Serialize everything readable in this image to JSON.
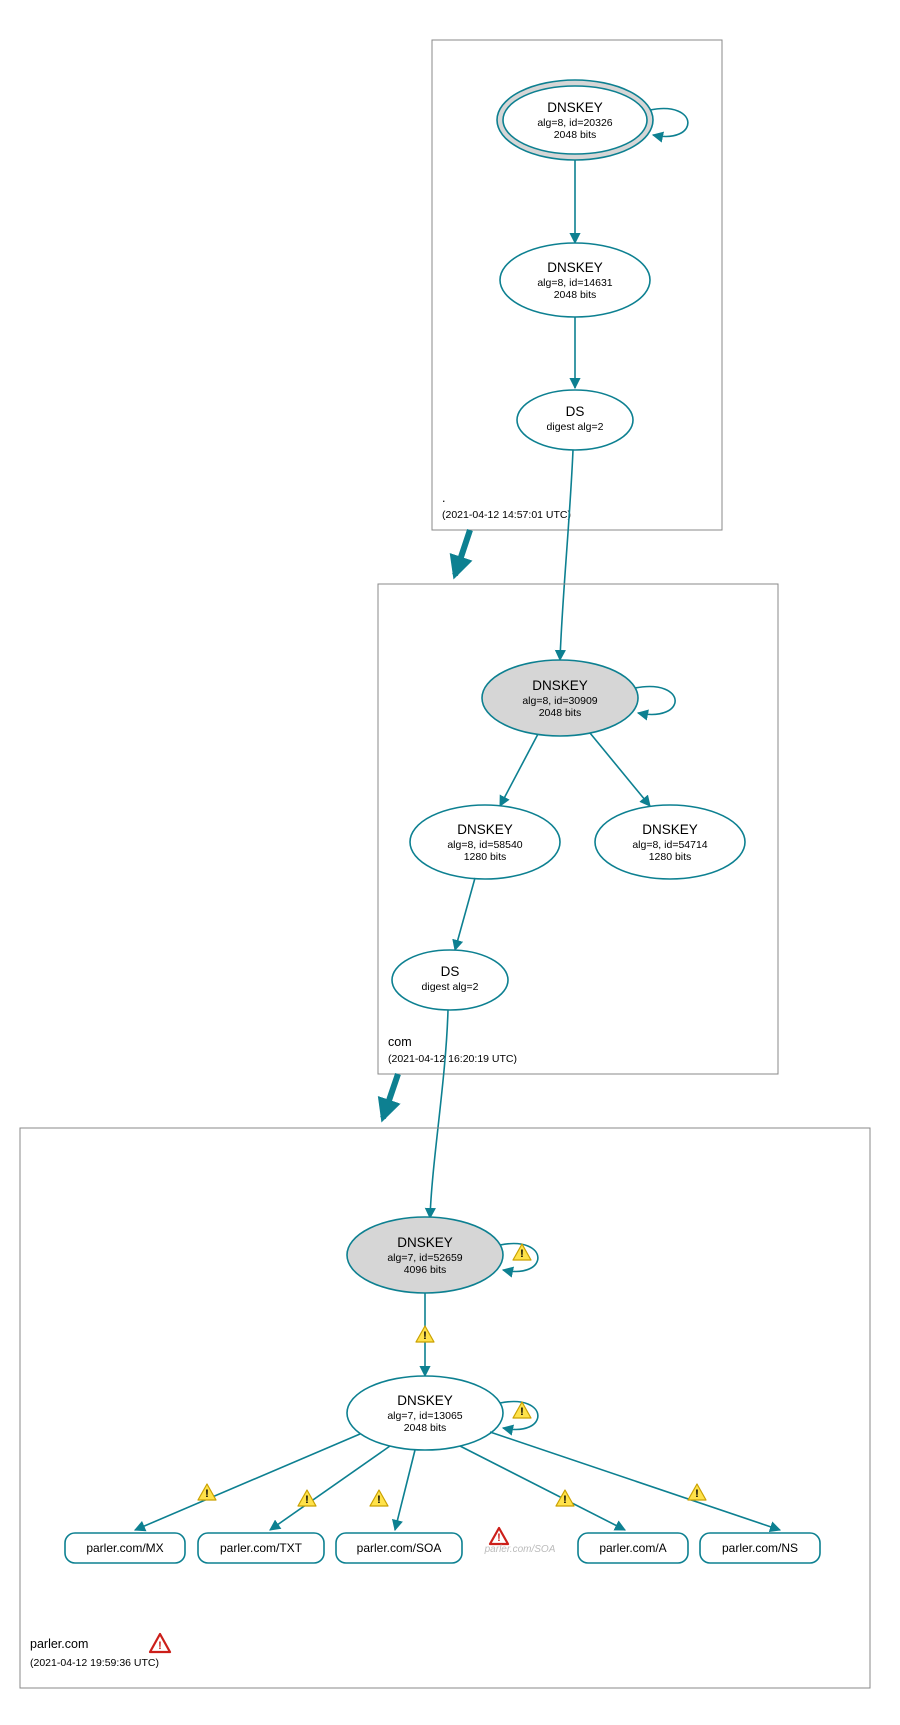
{
  "colors": {
    "accent": "#0d8091",
    "warn": "#ffe24a",
    "error": "#cc1f1a"
  },
  "zones": {
    "root": {
      "label": ".",
      "time": "(2021-04-12 14:57:01 UTC)"
    },
    "com": {
      "label": "com",
      "time": "(2021-04-12 16:20:19 UTC)"
    },
    "parler": {
      "label": "parler.com",
      "time": "(2021-04-12 19:59:36 UTC)"
    }
  },
  "nodes": {
    "root_ksk": {
      "title": "DNSKEY",
      "line1": "alg=8, id=20326",
      "line2": "2048 bits"
    },
    "root_zsk": {
      "title": "DNSKEY",
      "line1": "alg=8, id=14631",
      "line2": "2048 bits"
    },
    "root_ds": {
      "title": "DS",
      "line1": "digest alg=2"
    },
    "com_ksk": {
      "title": "DNSKEY",
      "line1": "alg=8, id=30909",
      "line2": "2048 bits"
    },
    "com_zsk1": {
      "title": "DNSKEY",
      "line1": "alg=8, id=58540",
      "line2": "1280 bits"
    },
    "com_zsk2": {
      "title": "DNSKEY",
      "line1": "alg=8, id=54714",
      "line2": "1280 bits"
    },
    "com_ds": {
      "title": "DS",
      "line1": "digest alg=2"
    },
    "parler_ksk": {
      "title": "DNSKEY",
      "line1": "alg=7, id=52659",
      "line2": "4096 bits"
    },
    "parler_zsk": {
      "title": "DNSKEY",
      "line1": "alg=7, id=13065",
      "line2": "2048 bits"
    }
  },
  "rrsets": {
    "mx": "parler.com/MX",
    "txt": "parler.com/TXT",
    "soa": "parler.com/SOA",
    "soa_dim": "parler.com/SOA",
    "a": "parler.com/A",
    "ns": "parler.com/NS"
  },
  "chart_data": {
    "type": "tree",
    "description": "DNSSEC authentication chain (DNSViz-style)",
    "zones": [
      {
        "name": ".",
        "analyzed": "2021-04-12 14:57:01 UTC"
      },
      {
        "name": "com",
        "analyzed": "2021-04-12 16:20:19 UTC"
      },
      {
        "name": "parler.com",
        "analyzed": "2021-04-12 19:59:36 UTC",
        "status": "error"
      }
    ],
    "nodes": [
      {
        "id": "root_ksk",
        "zone": ".",
        "type": "DNSKEY",
        "algorithm": 8,
        "key_id": 20326,
        "bits": 2048,
        "role": "KSK",
        "trust_anchor": true
      },
      {
        "id": "root_zsk",
        "zone": ".",
        "type": "DNSKEY",
        "algorithm": 8,
        "key_id": 14631,
        "bits": 2048,
        "role": "ZSK"
      },
      {
        "id": "root_ds",
        "zone": ".",
        "type": "DS",
        "digest_algorithm": 2
      },
      {
        "id": "com_ksk",
        "zone": "com",
        "type": "DNSKEY",
        "algorithm": 8,
        "key_id": 30909,
        "bits": 2048,
        "role": "KSK"
      },
      {
        "id": "com_zsk1",
        "zone": "com",
        "type": "DNSKEY",
        "algorithm": 8,
        "key_id": 58540,
        "bits": 1280,
        "role": "ZSK"
      },
      {
        "id": "com_zsk2",
        "zone": "com",
        "type": "DNSKEY",
        "algorithm": 8,
        "key_id": 54714,
        "bits": 1280,
        "role": "ZSK"
      },
      {
        "id": "com_ds",
        "zone": "com",
        "type": "DS",
        "digest_algorithm": 2
      },
      {
        "id": "parler_ksk",
        "zone": "parler.com",
        "type": "DNSKEY",
        "algorithm": 7,
        "key_id": 52659,
        "bits": 4096,
        "role": "KSK",
        "status": "warning"
      },
      {
        "id": "parler_zsk",
        "zone": "parler.com",
        "type": "DNSKEY",
        "algorithm": 7,
        "key_id": 13065,
        "bits": 2048,
        "role": "ZSK",
        "status": "warning"
      },
      {
        "id": "rr_mx",
        "zone": "parler.com",
        "type": "RRset",
        "name": "parler.com/MX"
      },
      {
        "id": "rr_txt",
        "zone": "parler.com",
        "type": "RRset",
        "name": "parler.com/TXT"
      },
      {
        "id": "rr_soa",
        "zone": "parler.com",
        "type": "RRset",
        "name": "parler.com/SOA"
      },
      {
        "id": "rr_soa_dim",
        "zone": "parler.com",
        "type": "RRset",
        "name": "parler.com/SOA",
        "status": "error"
      },
      {
        "id": "rr_a",
        "zone": "parler.com",
        "type": "RRset",
        "name": "parler.com/A"
      },
      {
        "id": "rr_ns",
        "zone": "parler.com",
        "type": "RRset",
        "name": "parler.com/NS"
      }
    ],
    "edges": [
      {
        "from": "root_ksk",
        "to": "root_ksk",
        "kind": "self-sig"
      },
      {
        "from": "root_ksk",
        "to": "root_zsk"
      },
      {
        "from": "root_zsk",
        "to": "root_ds"
      },
      {
        "from": ".",
        "to": "com",
        "kind": "delegation"
      },
      {
        "from": "root_ds",
        "to": "com_ksk"
      },
      {
        "from": "com_ksk",
        "to": "com_ksk",
        "kind": "self-sig"
      },
      {
        "from": "com_ksk",
        "to": "com_zsk1"
      },
      {
        "from": "com_ksk",
        "to": "com_zsk2"
      },
      {
        "from": "com_zsk1",
        "to": "com_ds"
      },
      {
        "from": "com",
        "to": "parler.com",
        "kind": "delegation"
      },
      {
        "from": "com_ds",
        "to": "parler_ksk"
      },
      {
        "from": "parler_ksk",
        "to": "parler_ksk",
        "kind": "self-sig",
        "status": "warning"
      },
      {
        "from": "parler_ksk",
        "to": "parler_zsk",
        "status": "warning"
      },
      {
        "from": "parler_zsk",
        "to": "parler_zsk",
        "kind": "self-sig",
        "status": "warning"
      },
      {
        "from": "parler_zsk",
        "to": "rr_mx",
        "status": "warning"
      },
      {
        "from": "parler_zsk",
        "to": "rr_txt",
        "status": "warning"
      },
      {
        "from": "parler_zsk",
        "to": "rr_soa",
        "status": "warning"
      },
      {
        "from": "parler_zsk",
        "to": "rr_a",
        "status": "warning"
      },
      {
        "from": "parler_zsk",
        "to": "rr_ns",
        "status": "warning"
      }
    ]
  }
}
